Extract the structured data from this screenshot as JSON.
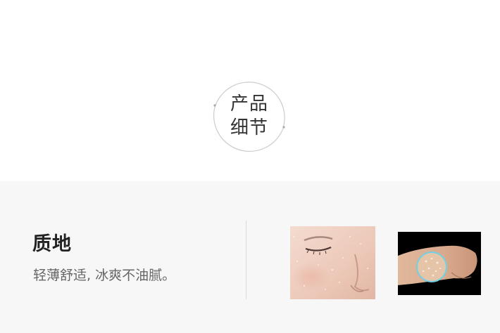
{
  "badge": {
    "line1": "产品",
    "line2": "细节"
  },
  "feature": {
    "title": "质地",
    "description": "轻薄舒适, 冰爽不油腻。"
  },
  "colors": {
    "top_background": "#ffffff",
    "bottom_background": "#f7f7f7",
    "badge_ring": "#cccccc",
    "title_text": "#222222",
    "description_text": "#666666",
    "divider": "#dcdcdc"
  }
}
